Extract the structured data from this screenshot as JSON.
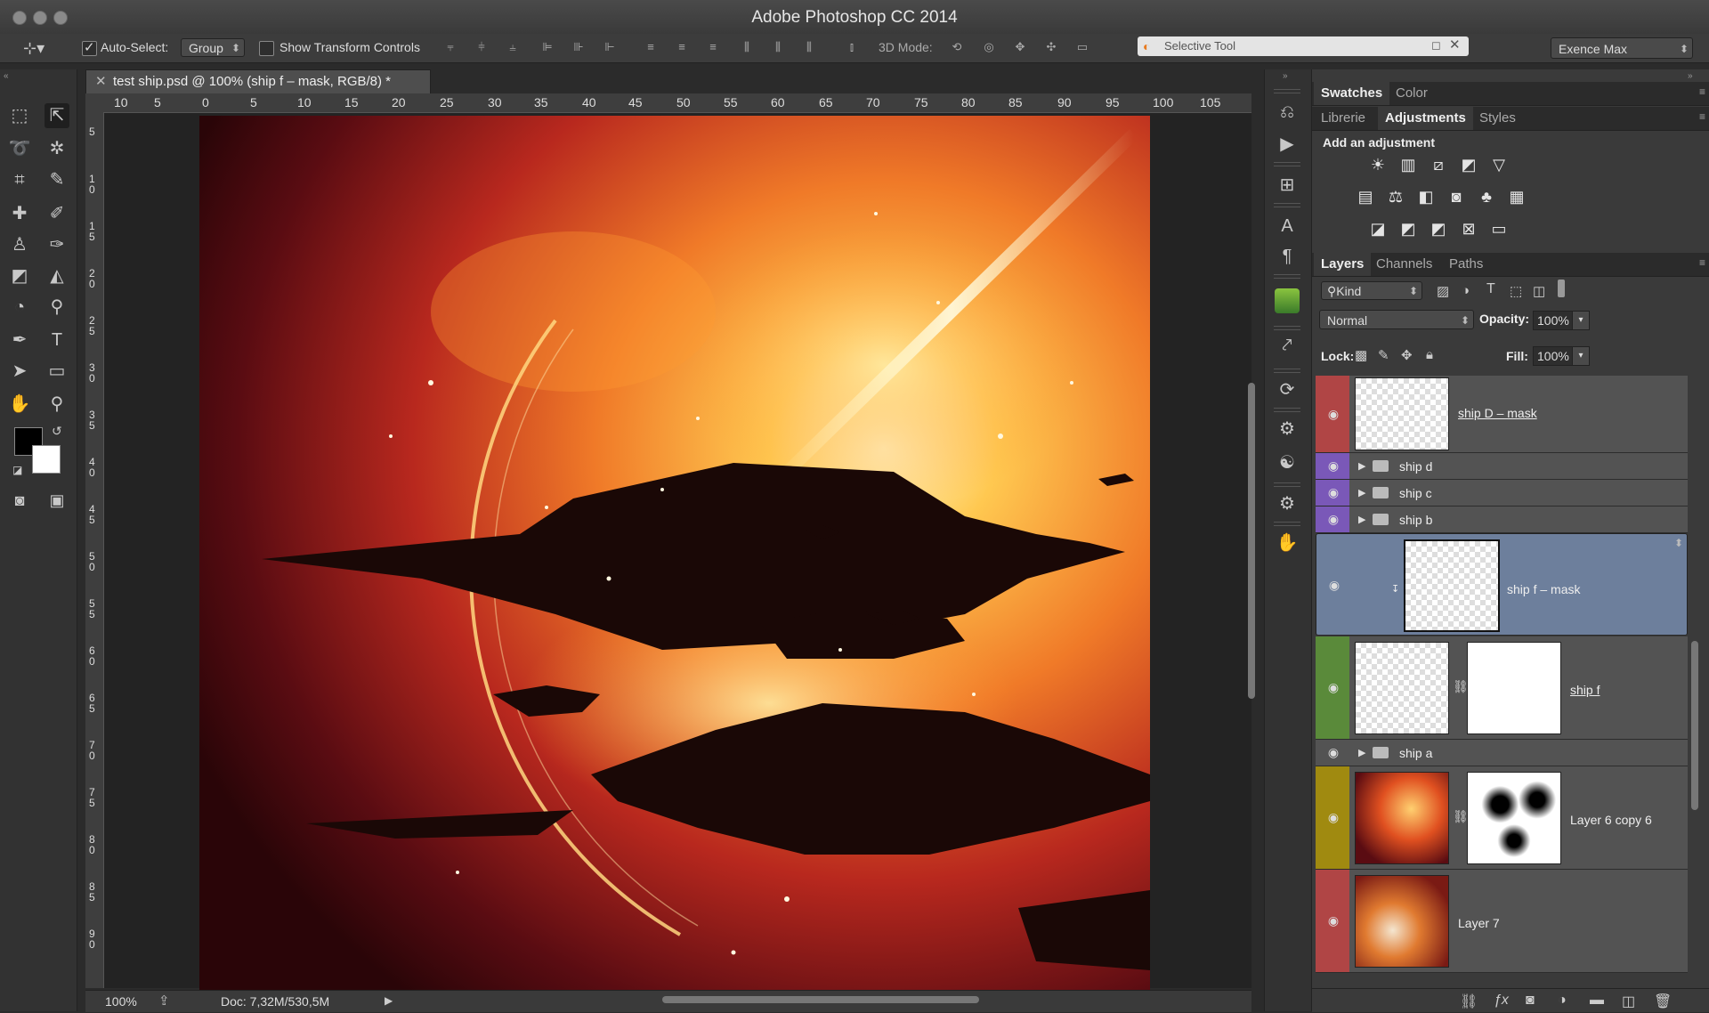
{
  "app": {
    "title": "Adobe Photoshop CC 2014"
  },
  "options": {
    "auto_select_label": "Auto-Select:",
    "auto_select_value": "Group",
    "show_transform_label": "Show Transform Controls",
    "mode_3d_label": "3D Mode:",
    "plugin_title": "Selective Tool",
    "workspace": "Exence Max"
  },
  "document": {
    "tab_title": "test ship.psd @ 100% (ship f – mask, RGB/8) *",
    "zoom": "100%",
    "doc_info": "Doc: 7,32M/530,5M",
    "ruler_top": [
      "10",
      "5",
      "0",
      "5",
      "10",
      "15",
      "20",
      "25",
      "30",
      "35",
      "40",
      "45",
      "50",
      "55",
      "60",
      "65",
      "70",
      "75",
      "80",
      "85",
      "90",
      "95",
      "100",
      "105"
    ],
    "ruler_left": [
      "5",
      "10",
      "15",
      "20",
      "25",
      "30",
      "35",
      "40",
      "45",
      "50",
      "55",
      "60",
      "65",
      "70",
      "75",
      "80",
      "85",
      "90"
    ]
  },
  "panels": {
    "top_tabs": [
      "Swatches",
      "Color"
    ],
    "mid_tabs": [
      "Librerie",
      "Adjustments",
      "Styles"
    ],
    "add_adjustment": "Add an adjustment",
    "layer_tabs": [
      "Layers",
      "Channels",
      "Paths"
    ],
    "filter_kind": "Kind",
    "blend_mode": "Normal",
    "opacity_label": "Opacity:",
    "opacity_value": "100%",
    "lock_label": "Lock:",
    "fill_label": "Fill:",
    "fill_value": "100%"
  },
  "layers": [
    {
      "name": "ship D – mask",
      "color": "#b04545"
    },
    {
      "name": "ship d",
      "color": "#7a58b8"
    },
    {
      "name": "ship c",
      "color": "#7a58b8"
    },
    {
      "name": "ship b",
      "color": "#7a58b8"
    },
    {
      "name": "ship f – mask",
      "color": "#535353"
    },
    {
      "name": "ship f",
      "color": "#5a8a3a"
    },
    {
      "name": "ship a",
      "color": "#535353"
    },
    {
      "name": "Layer 6 copy 6",
      "color": "#a08a10"
    },
    {
      "name": "Layer 7",
      "color": "#b04545"
    }
  ]
}
